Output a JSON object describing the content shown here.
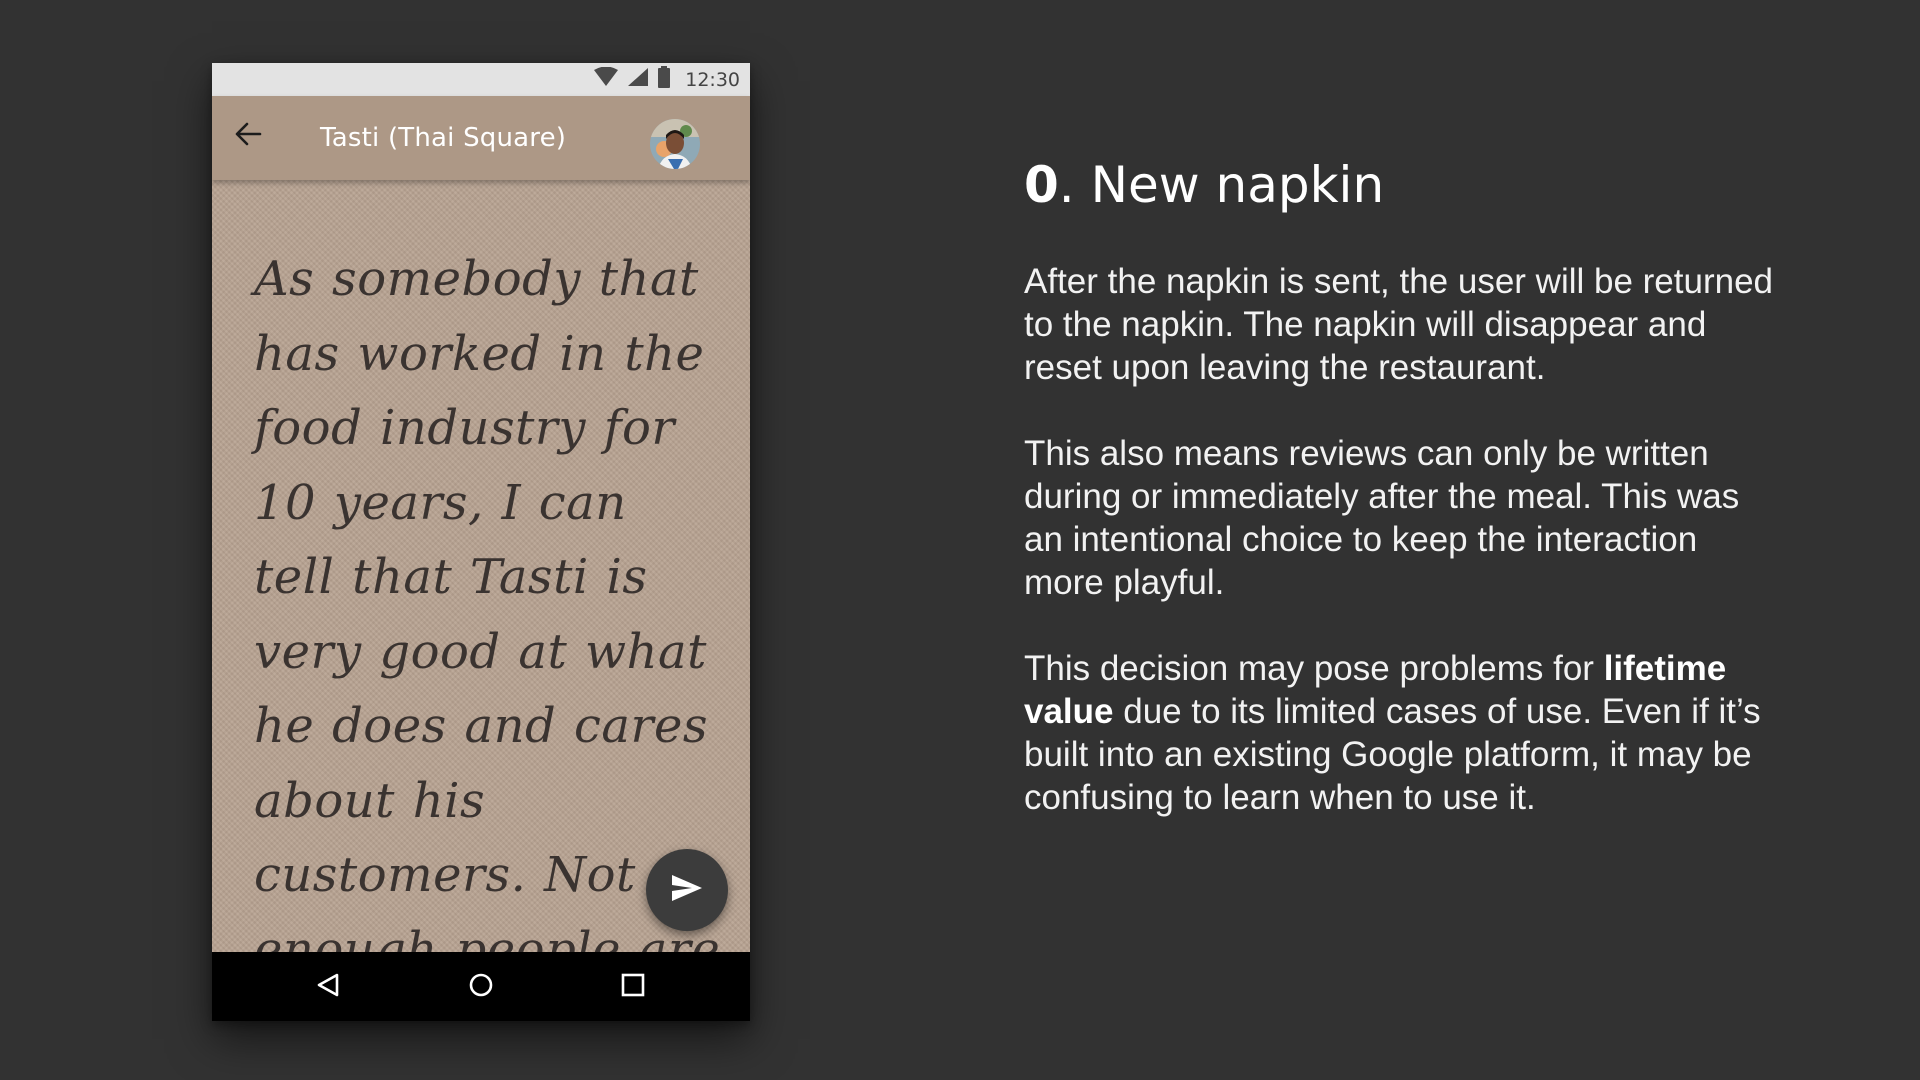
{
  "phone": {
    "status_bar": {
      "time": "12:30",
      "icons": [
        "wifi-icon",
        "cell-signal-icon",
        "battery-icon"
      ]
    },
    "app_bar": {
      "title": "Tasti (Thai Square)",
      "back_icon": "arrow-back-icon",
      "avatar_icon": "user-avatar"
    },
    "napkin": {
      "text": "As somebody that has worked in the food industry for 10 years, I can tell that Tasti is very good at what he does and cares about his customers. Not enough people are"
    },
    "send_button_icon": "send-icon",
    "nav_bar": {
      "icons": [
        "nav-back-icon",
        "nav-home-icon",
        "nav-recents-icon"
      ]
    }
  },
  "panel": {
    "heading_number": "0",
    "heading_title": ". New napkin",
    "paragraph_1": "After the napkin is sent, the user will be returned to the napkin. The napkin will disappear and reset upon leaving the restaurant.",
    "paragraph_2": "This also means reviews can only be written during or immediately after the meal. This was an intentional choice to keep the interaction more playful.",
    "paragraph_3_before": "This decision may pose problems for ",
    "paragraph_3_bold": "lifetime value",
    "paragraph_3_after": " due to its limited cases of use. Even if it’s built into an existing Google platform, it may be confusing to learn when to use it."
  },
  "colors": {
    "background": "#323232",
    "status_bar": "#e3e3e3",
    "app_bar": "#ad9886",
    "napkin": "#b7a291",
    "handwriting": "#3a3330",
    "fab": "#3c3c3c",
    "nav_bar": "#000000",
    "text": "#ffffff"
  }
}
